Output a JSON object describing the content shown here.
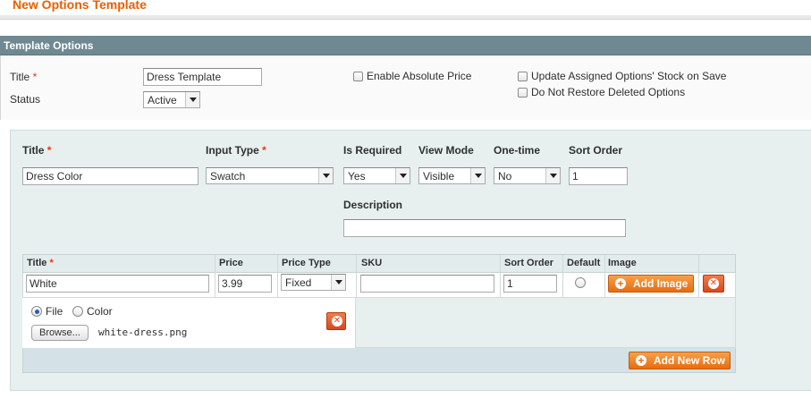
{
  "page": {
    "title": "New Options Template"
  },
  "section": {
    "title": "Template Options"
  },
  "template_form": {
    "title_label": "Title",
    "required_mark": "*",
    "title_value": "Dress Template",
    "status_label": "Status",
    "status_value": "Active",
    "enable_absolute_price_label": "Enable Absolute Price",
    "enable_absolute_price_checked": false,
    "update_stock_label": "Update Assigned Options' Stock on Save",
    "update_stock_checked": false,
    "no_restore_label": "Do Not Restore Deleted Options",
    "no_restore_checked": false
  },
  "option": {
    "headers": {
      "title": "Title",
      "input_type": "Input Type",
      "is_required": "Is Required",
      "view_mode": "View Mode",
      "one_time": "One-time",
      "sort_order": "Sort Order",
      "description": "Description"
    },
    "title_value": "Dress Color",
    "input_type_value": "Swatch",
    "is_required_value": "Yes",
    "view_mode_value": "Visible",
    "one_time_value": "No",
    "sort_order_value": "1",
    "description_value": ""
  },
  "values_table": {
    "columns": [
      "Title",
      "Price",
      "Price Type",
      "SKU",
      "Sort Order",
      "Default",
      "Image"
    ],
    "rows": [
      {
        "title": "White",
        "price": "3.99",
        "price_type": "Fixed",
        "sku": "",
        "sort_order": "1",
        "default": false,
        "add_image_label": "Add Image"
      }
    ],
    "image_source": {
      "file_label": "File",
      "color_label": "Color",
      "selected": "file",
      "browse_label": "Browse...",
      "file_name": "white-dress.png"
    },
    "add_new_row_label": "Add New Row"
  },
  "colors": {
    "accent": "#eb5e00",
    "header_bar": "#6f8992",
    "button_orange": "#e96c0f",
    "required": "#eb340a"
  }
}
